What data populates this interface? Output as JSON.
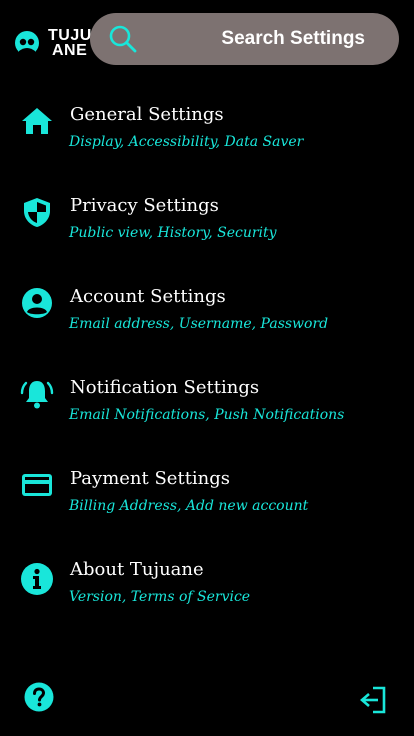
{
  "brand": {
    "line1": "TUJU",
    "line2": "ANE"
  },
  "search": {
    "placeholder": "Search Settings"
  },
  "menu": [
    {
      "title": "General Settings",
      "subtitle": "Display, Accessibility, Data Saver",
      "icon": "home-icon"
    },
    {
      "title": "Privacy Settings",
      "subtitle": "Public view, History, Security",
      "icon": "shield-icon"
    },
    {
      "title": "Account Settings",
      "subtitle": "Email address, Username, Password",
      "icon": "account-circle-icon"
    },
    {
      "title": "Notification Settings",
      "subtitle": "Email Notifications, Push Notifications",
      "icon": "bell-ringing-icon"
    },
    {
      "title": "Payment Settings",
      "subtitle": "Billing Address, Add new account",
      "icon": "credit-card-icon"
    },
    {
      "title": "About Tujuane",
      "subtitle": "Version, Terms of Service",
      "icon": "info-icon"
    }
  ],
  "footer": {
    "help_icon": "help-icon",
    "logout_icon": "logout-icon"
  },
  "colors": {
    "accent": "#19e6da",
    "background": "#000000",
    "search_bg": "#7d7271",
    "text": "#ffffff"
  }
}
